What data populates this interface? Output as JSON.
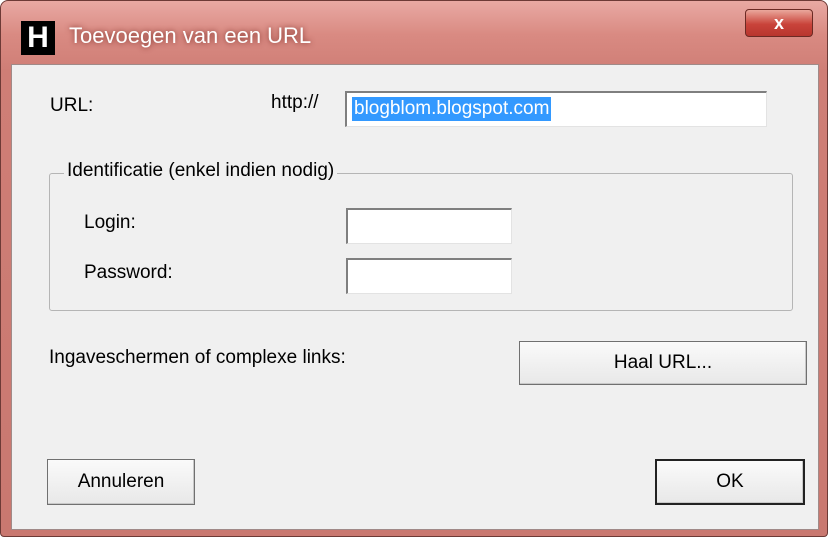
{
  "window": {
    "title": "Toevoegen van een URL",
    "icon_letter": "H",
    "close_symbol": "x"
  },
  "url": {
    "label": "URL:",
    "prefix": "http://",
    "value": "blogblom.blogspot.com"
  },
  "identification": {
    "legend": "Identificatie (enkel indien nodig)",
    "login_label": "Login:",
    "login_value": "",
    "password_label": "Password:",
    "password_value": ""
  },
  "complex": {
    "label": "Ingaveschermen of complexe links:",
    "button": "Haal URL..."
  },
  "buttons": {
    "cancel": "Annuleren",
    "ok": "OK"
  }
}
